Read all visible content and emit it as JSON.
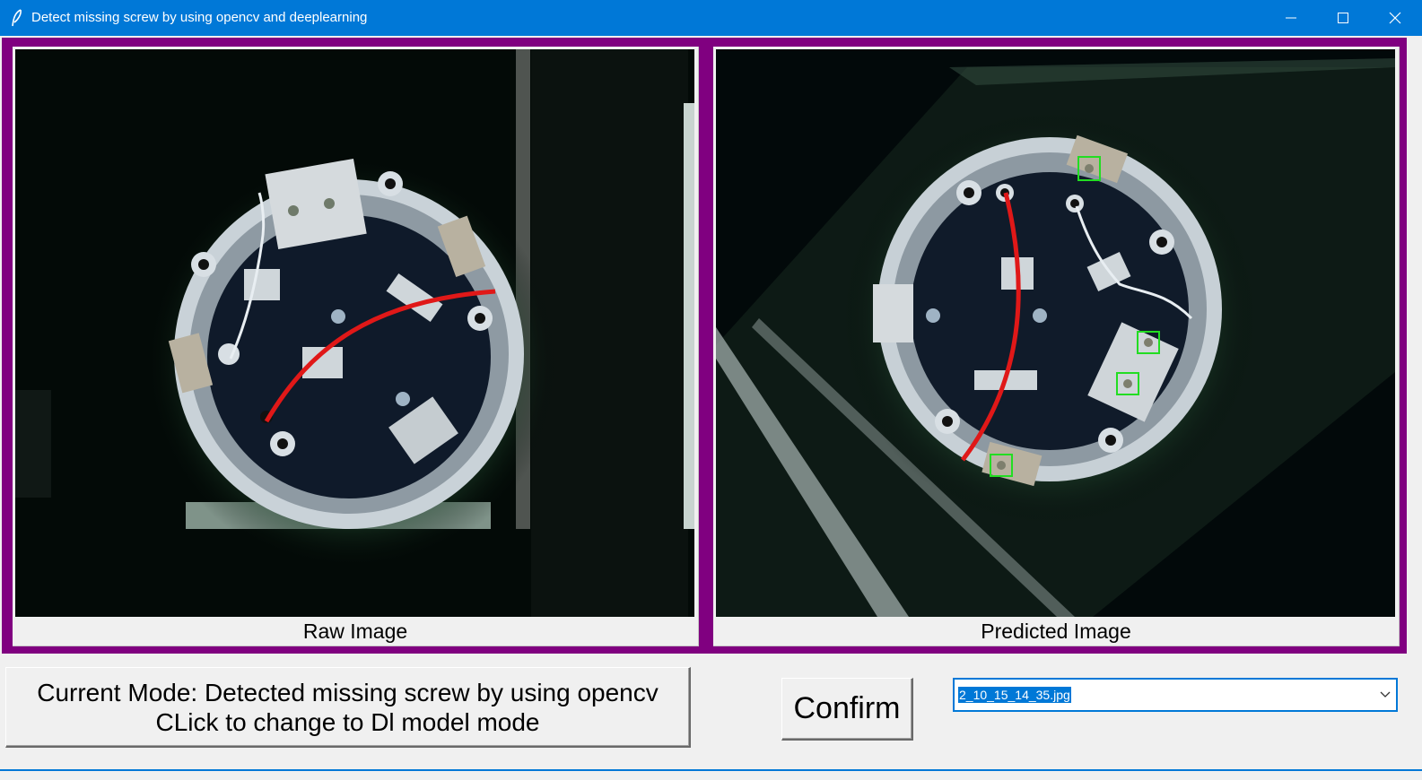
{
  "window": {
    "title": "Detect missing screw by using opencv and deeplearning",
    "icon": "feather-icon",
    "controls": [
      "minimize-icon",
      "maximize-icon",
      "close-icon"
    ],
    "accent": "#0078d7",
    "frame_color": "#800080"
  },
  "panels": {
    "raw": {
      "caption": "Raw Image"
    },
    "predicted": {
      "caption": "Predicted Image",
      "detection_count": 4,
      "box_color": "#22dd22"
    }
  },
  "mode_button": {
    "line1": "Current Mode: Detected missing screw by using opencv",
    "line2": "CLick to change to Dl model mode"
  },
  "confirm_button": {
    "label": "Confirm"
  },
  "file_select": {
    "value": "2_10_15_14_35.jpg",
    "icon": "chevron-down-icon"
  }
}
